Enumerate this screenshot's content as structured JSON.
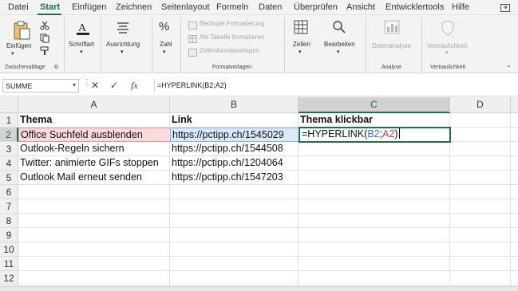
{
  "menu": {
    "tabs": [
      "Datei",
      "Start",
      "Einfügen",
      "Zeichnen",
      "Seitenlayout",
      "Formeln",
      "Daten",
      "Überprüfen",
      "Ansicht",
      "Entwicklertools",
      "Hilfe"
    ],
    "active_tab": "Start"
  },
  "ribbon": {
    "paste_label": "Einfügen",
    "clipboard_group": "Zwischenablage",
    "font_label": "Schriftart",
    "alignment_label": "Ausrichtung",
    "number_label": "Zahl",
    "percent_symbol": "%",
    "cond_format": "Bedingte Formatierung",
    "table_format": "Als Tabelle formatieren",
    "cell_styles": "Zellenformatvorlagen",
    "styles_group": "Formatvorlagen",
    "cells_label": "Zellen",
    "edit_label": "Bearbeiten",
    "analyze_data": "Datenanalyse",
    "analyze_group": "Analyse",
    "sensitivity_label": "Vertraulichkeit",
    "sensitivity_group": "Vertraulichkeit"
  },
  "formula_bar": {
    "name_box": "SUMME",
    "cancel_symbol": "✕",
    "enter_symbol": "✓",
    "fx_symbol": "fx",
    "formula": "=HYPERLINK(B2;A2)"
  },
  "sheet": {
    "columns": [
      "A",
      "B",
      "C",
      "D"
    ],
    "rows": [
      "1",
      "2",
      "3",
      "4",
      "5",
      "6",
      "7",
      "8",
      "9",
      "10",
      "11",
      "12"
    ],
    "headers": {
      "A": "Thema",
      "B": "Link",
      "C": "Thema klickbar"
    },
    "data": [
      {
        "A": "Office Suchfeld ausblenden",
        "B": "https://pctipp.ch/1545029"
      },
      {
        "A": "Outlook-Regeln sichern",
        "B": "https://pctipp.ch/1544508"
      },
      {
        "A": "Twitter: animierte GIFs stoppen",
        "B": "https://pctipp.ch/1204064"
      },
      {
        "A": "Outlook Mail erneut senden",
        "B": "https://pctipp.ch/1547203"
      }
    ],
    "editing_cell": {
      "prefix": "=HYPERLINK(",
      "ref1": "B2",
      "separator": ";",
      "ref2": "A2",
      "suffix": ")"
    },
    "active_column": "C",
    "active_row": "2"
  },
  "colors": {
    "accent": "#1f7244",
    "ref_b": "#3a6fc4",
    "ref_a": "#c43a52"
  }
}
